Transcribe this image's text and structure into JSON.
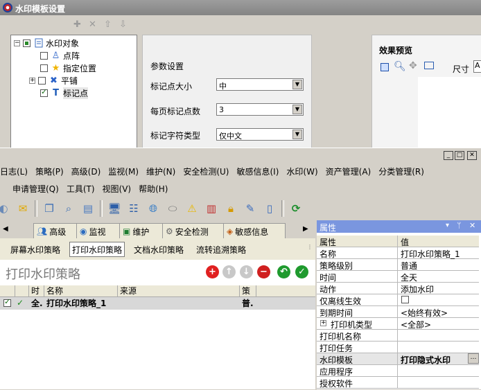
{
  "dialog": {
    "title": "水印模板设置",
    "tree": {
      "root": "水印对象",
      "items": [
        {
          "label": "点阵",
          "checked": false
        },
        {
          "label": "指定位置",
          "checked": false
        },
        {
          "label": "平铺",
          "checked": false,
          "expandable": true
        },
        {
          "label": "标记点",
          "checked": true
        }
      ]
    },
    "params": {
      "heading": "参数设置",
      "fields": [
        {
          "label": "标记点大小",
          "value": "中"
        },
        {
          "label": "每页标记点数",
          "value": "3"
        },
        {
          "label": "标记字符类型",
          "value": "仅中文"
        }
      ]
    },
    "preview": {
      "heading": "效果预览",
      "size_label": "尺寸",
      "size_value": "A"
    }
  },
  "main": {
    "menu_row1": [
      "日志(L)",
      "策略(P)",
      "高级(D)",
      "监视(M)",
      "维护(N)",
      "安全检测(U)",
      "敏感信息(I)",
      "水印(W)",
      "资产管理(A)",
      "分类管理(R)"
    ],
    "menu_row2": [
      "申请管理(Q)",
      "工具(T)",
      "视图(V)",
      "帮助(H)"
    ],
    "tabs": [
      "高级",
      "监视",
      "维护",
      "安全检测",
      "敏感信息"
    ],
    "subtabs": [
      "屏幕水印策略",
      "打印水印策略",
      "文档水印策略",
      "流转追溯策略"
    ],
    "active_subtab": 1,
    "list": {
      "title": "打印水印策略",
      "columns": [
        "",
        "",
        "时",
        "名称",
        "来源",
        "策",
        ""
      ],
      "rows": [
        {
          "time": "全.",
          "name": "打印水印策略_1",
          "source": "",
          "policy": "普."
        }
      ]
    },
    "properties": {
      "title": "属性",
      "header": {
        "key": "属性",
        "value": "值"
      },
      "rows": [
        {
          "key": "名称",
          "value": "打印水印策略_1"
        },
        {
          "key": "策略级别",
          "value": "普通"
        },
        {
          "key": "时间",
          "value": "全天"
        },
        {
          "key": "动作",
          "value": "添加水印"
        },
        {
          "key": "仅离线生效",
          "value": ""
        },
        {
          "key": "到期时间",
          "value": "<始终有效>"
        },
        {
          "key": "打印机类型",
          "value": "<全部>"
        },
        {
          "key": "打印机名称",
          "value": ""
        },
        {
          "key": "打印任务",
          "value": ""
        },
        {
          "key": "水印模板",
          "value": "打印隐式水印"
        },
        {
          "key": "应用程序",
          "value": ""
        },
        {
          "key": "授权软件",
          "value": ""
        }
      ]
    }
  }
}
